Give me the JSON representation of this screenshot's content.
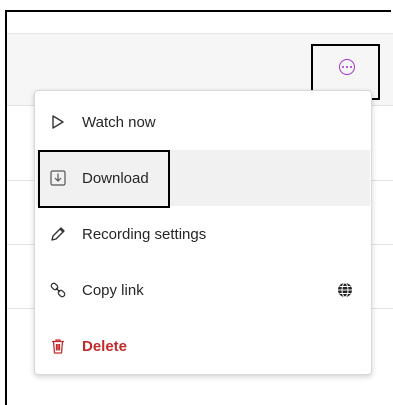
{
  "menu": {
    "items": [
      {
        "label": "Watch now",
        "icon": "play-icon"
      },
      {
        "label": "Download",
        "icon": "download-icon"
      },
      {
        "label": "Recording settings",
        "icon": "pencil-icon"
      },
      {
        "label": "Copy link",
        "icon": "link-icon",
        "trailing_icon": "globe-icon"
      },
      {
        "label": "Delete",
        "icon": "trash-icon"
      }
    ]
  },
  "colors": {
    "accent": "#a233c9",
    "danger": "#c02c2c",
    "hover_bg": "#f1f1f1"
  }
}
